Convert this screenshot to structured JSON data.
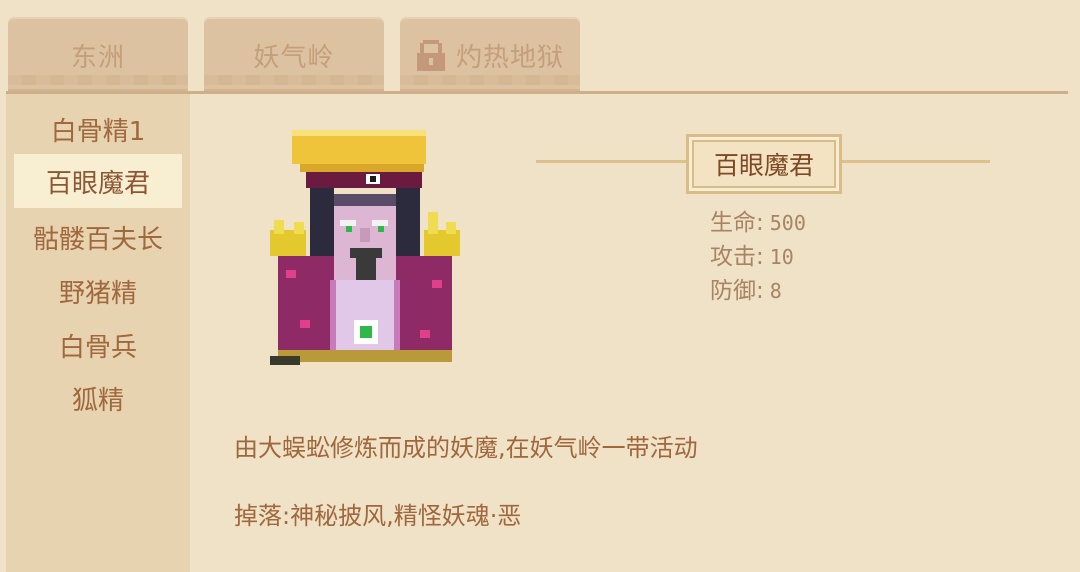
{
  "tabs": [
    {
      "label": "东洲",
      "locked": false
    },
    {
      "label": "妖气岭",
      "locked": false
    },
    {
      "label": "灼热地狱",
      "locked": true
    }
  ],
  "sidebar": {
    "items": [
      {
        "label": "白骨精1",
        "selected": false
      },
      {
        "label": "百眼魔君",
        "selected": true
      },
      {
        "label": "骷髅百夫长",
        "selected": false
      },
      {
        "label": "野猪精",
        "selected": false
      },
      {
        "label": "白骨兵",
        "selected": false
      },
      {
        "label": "狐精",
        "selected": false
      }
    ]
  },
  "monster": {
    "name": "百眼魔君",
    "stats": [
      {
        "label": "生命:",
        "value": "500"
      },
      {
        "label": "攻击:",
        "value": "10"
      },
      {
        "label": "防御:",
        "value": "8"
      }
    ],
    "description": "由大蜈蚣修炼而成的妖魔,在妖气岭一带活动",
    "drops": "掉落:神秘披风,精怪妖魂·恶"
  },
  "colors": {
    "background": "#efe2c6",
    "sidebar": "#e8d3b1",
    "tab": "#dcc2a0",
    "text": "#a0673d",
    "selected_bg": "#f8eed2"
  },
  "icons": {
    "locked_tab": "lock-icon"
  }
}
